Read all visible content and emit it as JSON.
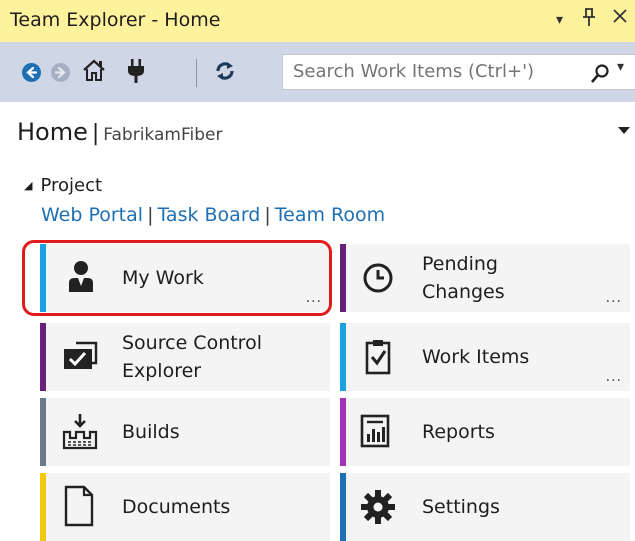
{
  "window": {
    "title": "Team Explorer - Home",
    "dropdown_glyph": "▾",
    "pin_glyph": "ᵽ",
    "close_glyph": "✕"
  },
  "toolbar": {
    "back_icon": "back-arrow-icon",
    "forward_icon": "forward-arrow-icon",
    "home_icon": "home-icon",
    "connect_icon": "plug-icon",
    "refresh_icon": "refresh-icon",
    "search_placeholder": "Search Work Items (Ctrl+')"
  },
  "header": {
    "title": "Home",
    "separator": "|",
    "project": "FabrikamFiber"
  },
  "project_section": {
    "label": "Project",
    "links": [
      "Web Portal",
      "Task Board",
      "Team Room"
    ],
    "link_separator": "|"
  },
  "tiles": [
    {
      "label": "My Work",
      "icon": "person-icon",
      "accent": "#1ba1e2",
      "more": "..."
    },
    {
      "label": "Pending Changes",
      "icon": "clock-icon",
      "accent": "#68217a",
      "more": "..."
    },
    {
      "label": "Source Control Explorer",
      "icon": "folder-check-icon",
      "accent": "#68217a",
      "more": ""
    },
    {
      "label": "Work Items",
      "icon": "clipboard-check-icon",
      "accent": "#1ba1e2",
      "more": "..."
    },
    {
      "label": "Builds",
      "icon": "build-icon",
      "accent": "#6d7a8a",
      "more": ""
    },
    {
      "label": "Reports",
      "icon": "report-icon",
      "accent": "#a333b8",
      "more": ""
    },
    {
      "label": "Documents",
      "icon": "document-icon",
      "accent": "#f2c811",
      "more": ""
    },
    {
      "label": "Settings",
      "icon": "gear-icon",
      "accent": "#1e6fb3",
      "more": ""
    }
  ],
  "highlight": {
    "target": "My Work",
    "color": "#e11b1b"
  }
}
